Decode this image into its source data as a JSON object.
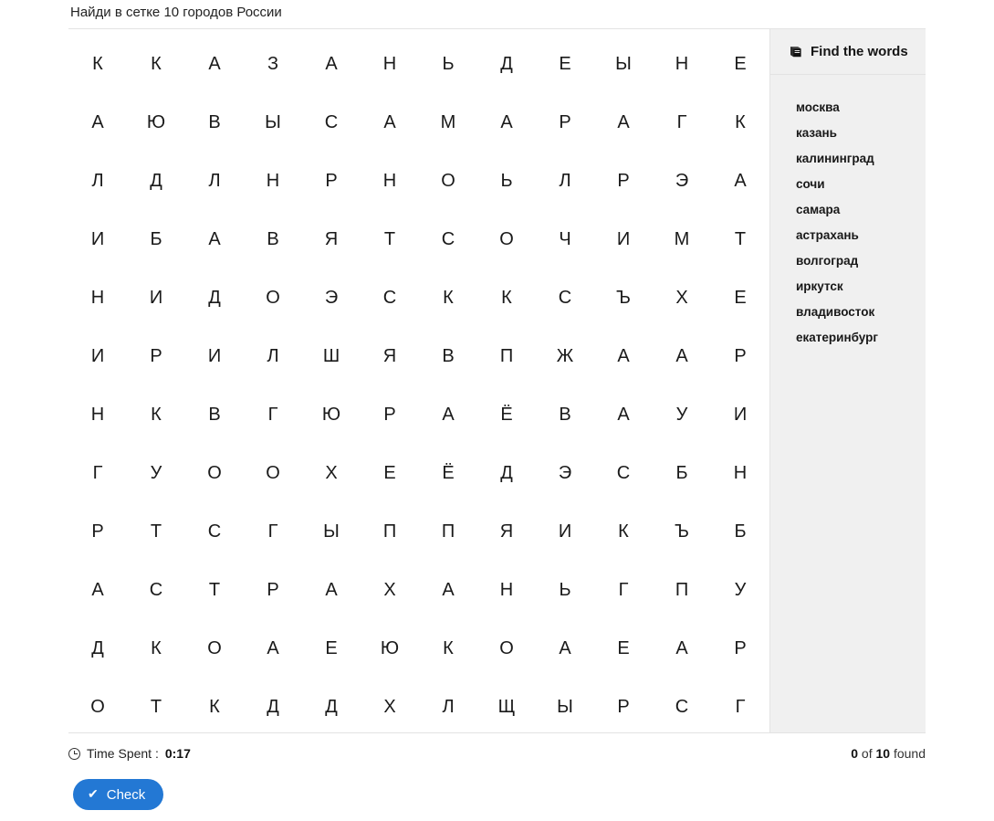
{
  "page": {
    "title": "Найди в сетке 10 городов России"
  },
  "sidebar": {
    "header_label": "Find the words",
    "header_icon": "book-icon",
    "words": [
      "москва",
      "казань",
      "калининград",
      "сочи",
      "самара",
      "астрахань",
      "волгоград",
      "иркутск",
      "владивосток",
      "екатеринбург"
    ]
  },
  "grid": {
    "rows": 12,
    "cols": 12,
    "letters": [
      [
        "К",
        "К",
        "А",
        "З",
        "А",
        "Н",
        "Ь",
        "Д",
        "Е",
        "Ы",
        "Н",
        "Е"
      ],
      [
        "А",
        "Ю",
        "В",
        "Ы",
        "С",
        "А",
        "М",
        "А",
        "Р",
        "А",
        "Г",
        "К"
      ],
      [
        "Л",
        "Д",
        "Л",
        "Н",
        "Р",
        "Н",
        "О",
        "Ь",
        "Л",
        "Р",
        "Э",
        "А"
      ],
      [
        "И",
        "Б",
        "А",
        "В",
        "Я",
        "Т",
        "С",
        "О",
        "Ч",
        "И",
        "М",
        "Т"
      ],
      [
        "Н",
        "И",
        "Д",
        "О",
        "Э",
        "С",
        "К",
        "К",
        "С",
        "Ъ",
        "Х",
        "Е"
      ],
      [
        "И",
        "Р",
        "И",
        "Л",
        "Ш",
        "Я",
        "В",
        "П",
        "Ж",
        "А",
        "А",
        "Р"
      ],
      [
        "Н",
        "К",
        "В",
        "Г",
        "Ю",
        "Р",
        "А",
        "Ё",
        "В",
        "А",
        "У",
        "И"
      ],
      [
        "Г",
        "У",
        "О",
        "О",
        "Х",
        "Е",
        "Ё",
        "Д",
        "Э",
        "С",
        "Б",
        "Н"
      ],
      [
        "Р",
        "Т",
        "С",
        "Г",
        "Ы",
        "П",
        "П",
        "Я",
        "И",
        "К",
        "Ъ",
        "Б"
      ],
      [
        "А",
        "С",
        "Т",
        "Р",
        "А",
        "Х",
        "А",
        "Н",
        "Ь",
        "Г",
        "П",
        "У"
      ],
      [
        "Д",
        "К",
        "О",
        "А",
        "Е",
        "Ю",
        "К",
        "О",
        "А",
        "Е",
        "А",
        "Р"
      ],
      [
        "О",
        "Т",
        "К",
        "Д",
        "Д",
        "Х",
        "Л",
        "Щ",
        "Ы",
        "Р",
        "С",
        "Г"
      ]
    ]
  },
  "footer": {
    "time_icon": "clock-icon",
    "time_label": "Time Spent :",
    "time_value": "0:17",
    "found_count": "0",
    "found_of": "of",
    "found_total": "10",
    "found_suffix": "found"
  },
  "actions": {
    "check_label": "Check",
    "check_icon": "checkmark-icon",
    "check_glyph": "✔"
  },
  "colors": {
    "accent": "#2378d4",
    "sidebar_bg": "#f0f0f0",
    "border": "#e3e3e3",
    "text": "#222222"
  }
}
